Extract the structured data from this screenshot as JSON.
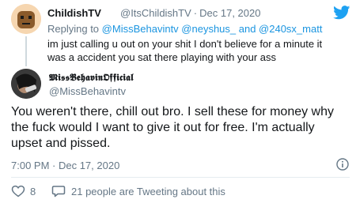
{
  "quoted_tweet": {
    "display_name": "ChildishTV",
    "handle": "@ItsChildishTV",
    "separator": "·",
    "date": "Dec 17, 2020",
    "replying_prefix": "Replying to",
    "replying_to": "@MissBehavintv @neyshus_ and @240sx_matt",
    "text": "im just calling u out on your shit I don't believe for a minute it was a accident you sat there playing with your ass"
  },
  "main_tweet": {
    "display_name": "𝕸𝖎𝖘𝖘𝕭𝖊𝖍𝖆𝖛𝖎𝖓𝕺𝖋𝖋𝖎𝖈𝖎𝖆𝖑",
    "handle": "@MissBehavintv",
    "text": "You weren't there, chill out bro. I sell these for money why the fuck would I want to give it out for free. I'm actually upset and pissed.",
    "timestamp": "7:00 PM · Dec 17, 2020"
  },
  "engagement": {
    "likes": "8",
    "talking": "21 people are Tweeting about this"
  },
  "colors": {
    "brand_blue": "#1da1f2",
    "link_blue": "#1b95e0",
    "muted": "#657786"
  },
  "icons": [
    "twitter-bird-icon",
    "info-icon",
    "heart-icon",
    "speech-bubble-icon"
  ]
}
